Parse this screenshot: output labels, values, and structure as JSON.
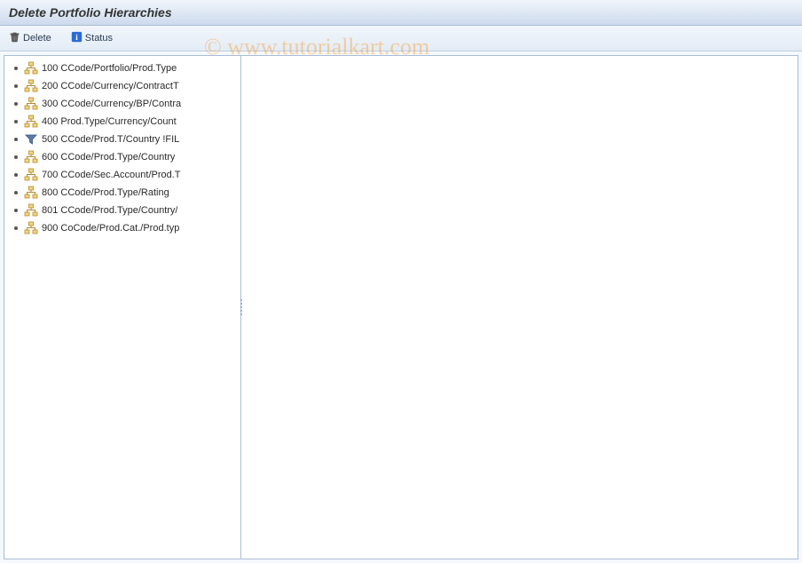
{
  "header": {
    "title": "Delete Portfolio Hierarchies"
  },
  "toolbar": {
    "delete_label": "Delete",
    "status_label": "Status"
  },
  "tree": {
    "items": [
      {
        "icon": "hierarchy",
        "label": "100 CCode/Portfolio/Prod.Type"
      },
      {
        "icon": "hierarchy",
        "label": "200 CCode/Currency/ContractT"
      },
      {
        "icon": "hierarchy",
        "label": "300 CCode/Currency/BP/Contra"
      },
      {
        "icon": "hierarchy",
        "label": "400 Prod.Type/Currency/Count"
      },
      {
        "icon": "filter",
        "label": "500 CCode/Prod.T/Country !FIL"
      },
      {
        "icon": "hierarchy",
        "label": "600 CCode/Prod.Type/Country"
      },
      {
        "icon": "hierarchy",
        "label": "700 CCode/Sec.Account/Prod.T"
      },
      {
        "icon": "hierarchy",
        "label": "800 CCode/Prod.Type/Rating"
      },
      {
        "icon": "hierarchy",
        "label": "801 CCode/Prod.Type/Country/"
      },
      {
        "icon": "hierarchy",
        "label": "900 CoCode/Prod.Cat./Prod.typ"
      }
    ]
  },
  "watermark": "© www.tutorialkart.com"
}
